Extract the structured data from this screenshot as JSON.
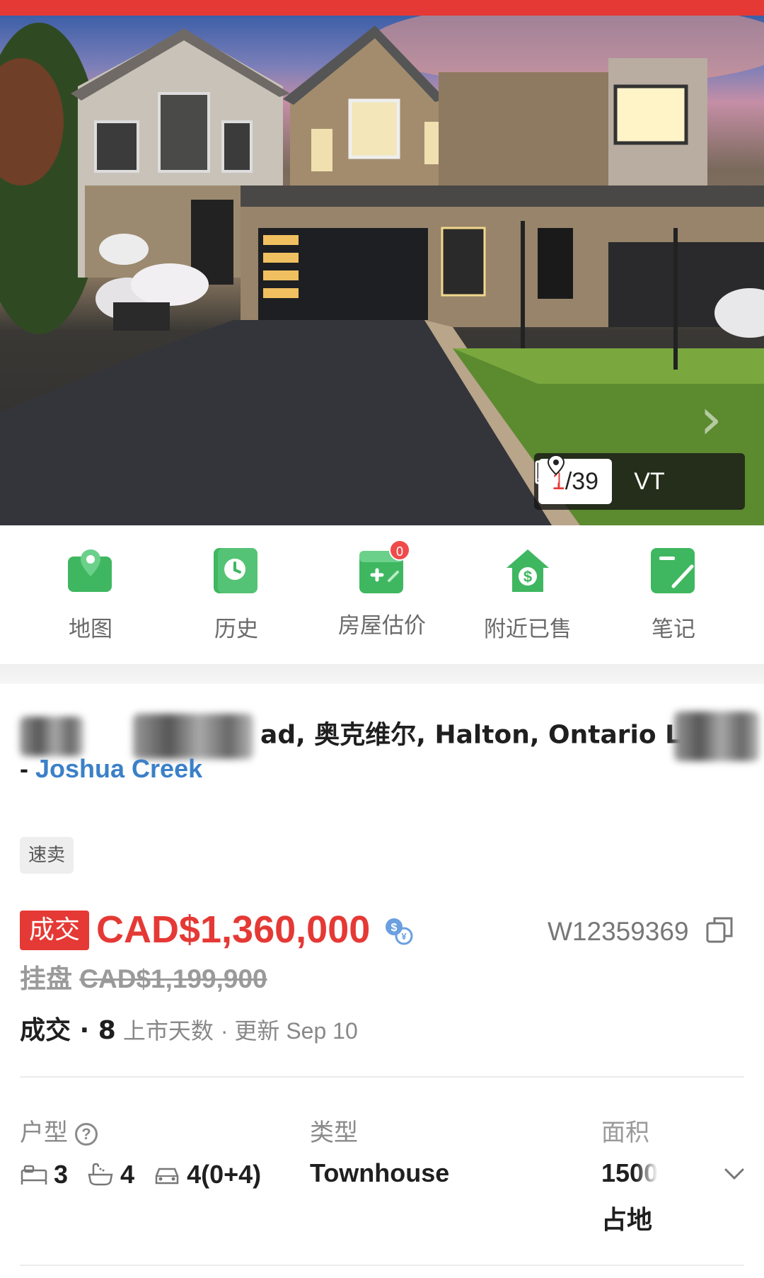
{
  "colors": {
    "accent": "#e53935",
    "link": "#3b80c8",
    "icon_green": "#3fb760"
  },
  "gallery": {
    "current": "1",
    "total_sep": "/39",
    "vt_label": "VT",
    "next_icon": "chevron-right-icon"
  },
  "quick_nav": [
    {
      "label": "地图",
      "icon": "map-pin-icon"
    },
    {
      "label": "历史",
      "icon": "clock-icon"
    },
    {
      "label": "房屋估价",
      "icon": "estimate-icon",
      "badge": "0"
    },
    {
      "label": "附近已售",
      "icon": "house-dollar-icon"
    },
    {
      "label": "笔记",
      "icon": "note-icon"
    }
  ],
  "listing": {
    "address_visible": "ad, 奥克维尔, Halton, Ontario L",
    "community_prefix": "- ",
    "community": "Joshua Creek",
    "tag": "速卖",
    "sold_badge": "成交",
    "sold_price": "CAD$1,360,000",
    "mls": "W12359369",
    "list_label": "挂盘",
    "list_price": "CAD$1,199,900",
    "status_label": "成交",
    "dot": " · ",
    "days": "8",
    "days_label": "上市天数",
    "updated": " · 更新 Sep 10"
  },
  "specs": {
    "layout_label": "户型",
    "type_label": "类型",
    "area_label": "面积",
    "beds": "3",
    "baths": "4",
    "parking": "4(0+4)",
    "type_value": "Townhouse",
    "area_value": "1500",
    "lot_label": "占地"
  }
}
